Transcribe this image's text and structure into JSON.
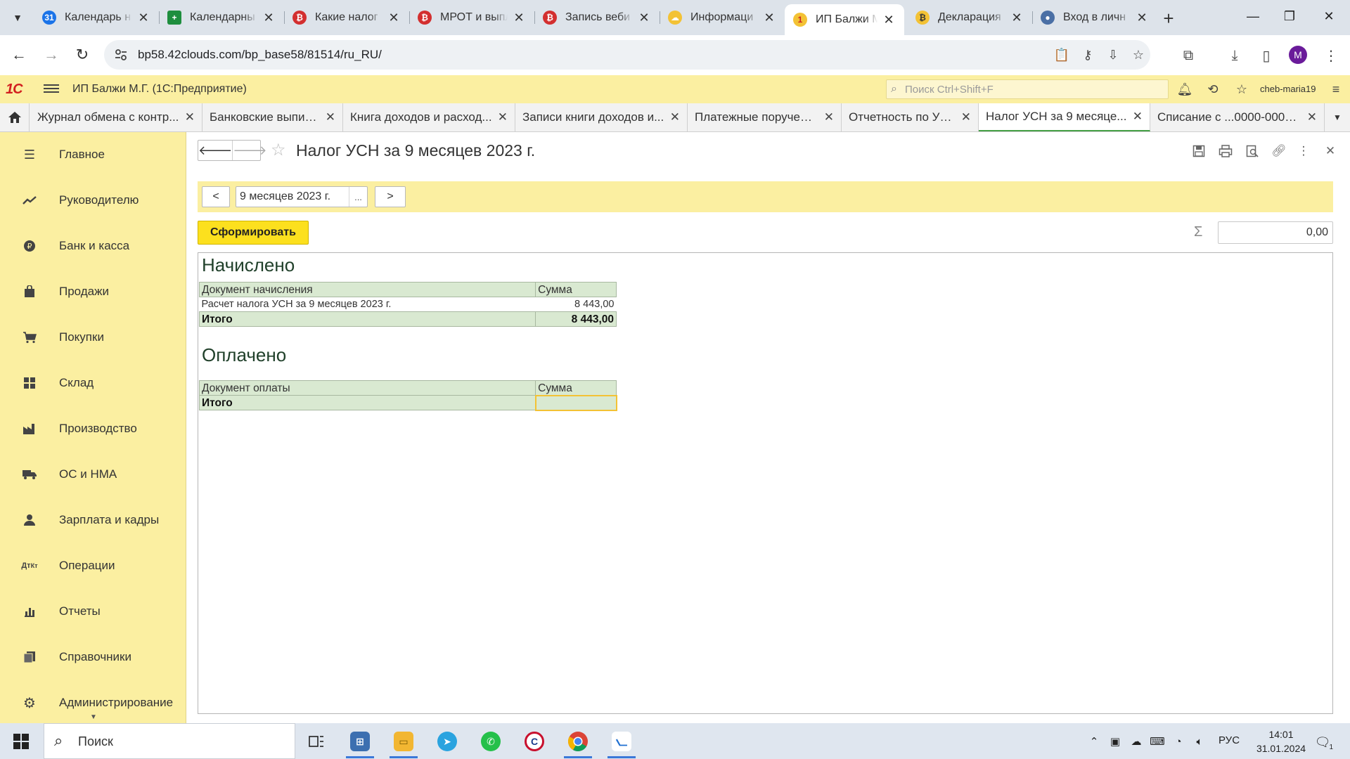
{
  "browser": {
    "tabs": [
      {
        "title": "Календарь н",
        "favicon": "google-calendar-icon",
        "color": "#1a73e8"
      },
      {
        "title": "Календарны",
        "favicon": "google-sheets-icon",
        "color": "#1e8e3e"
      },
      {
        "title": "Какие налог",
        "favicon": "buh-icon",
        "color": "#d32f2f"
      },
      {
        "title": "МРОТ и выпл",
        "favicon": "buh-icon",
        "color": "#d32f2f"
      },
      {
        "title": "Запись веби",
        "favicon": "buh-icon",
        "color": "#d32f2f"
      },
      {
        "title": "Информаци",
        "favicon": "cloud-icon",
        "color": "#f3c235"
      },
      {
        "title": "ИП Балжи М",
        "favicon": "1c-icon",
        "color": "#f3c235"
      },
      {
        "title": "Декларация",
        "favicon": "buh-icon",
        "color": "#f3c235"
      },
      {
        "title": "Вход в личн",
        "favicon": "fns-icon",
        "color": "#4a6fa5"
      }
    ],
    "url": "bp58.42clouds.com/bp_base58/81514/ru_RU/",
    "profile_letter": "M"
  },
  "app": {
    "logo": "1С",
    "title": "ИП Балжи М.Г.  (1С:Предприятие)",
    "search_placeholder": "Поиск Ctrl+Shift+F",
    "user": "cheb-maria19"
  },
  "open_windows": [
    {
      "title": "Журнал обмена с контр..."
    },
    {
      "title": "Банковские выписки"
    },
    {
      "title": "Книга доходов и расход..."
    },
    {
      "title": "Записи книги доходов и..."
    },
    {
      "title": "Платежные поручения"
    },
    {
      "title": "Отчетность по УСН"
    },
    {
      "title": "Налог УСН за 9 месяце...",
      "active": true
    },
    {
      "title": "Списание с ...0000-000021"
    }
  ],
  "sidebar": {
    "items": [
      {
        "label": "Главное",
        "icon": "menu-lines-icon"
      },
      {
        "label": "Руководителю",
        "icon": "trend-icon"
      },
      {
        "label": "Банк и касса",
        "icon": "ruble-coin-icon"
      },
      {
        "label": "Продажи",
        "icon": "shopping-bag-icon"
      },
      {
        "label": "Покупки",
        "icon": "cart-icon"
      },
      {
        "label": "Склад",
        "icon": "warehouse-icon"
      },
      {
        "label": "Производство",
        "icon": "factory-icon"
      },
      {
        "label": "ОС и НМА",
        "icon": "truck-icon"
      },
      {
        "label": "Зарплата и кадры",
        "icon": "person-icon"
      },
      {
        "label": "Операции",
        "icon": "dt-kt-icon"
      },
      {
        "label": "Отчеты",
        "icon": "bar-chart-icon"
      },
      {
        "label": "Справочники",
        "icon": "books-icon"
      },
      {
        "label": "Администрирование",
        "icon": "gear-icon"
      }
    ]
  },
  "form": {
    "title": "Налог УСН за 9 месяцев 2023 г.",
    "period_prev": "<",
    "period_value": "9 месяцев 2023 г.",
    "period_select": "...",
    "period_next": ">",
    "generate_label": "Сформировать",
    "sum_value": "0,00",
    "accrued": {
      "title": "Начислено",
      "col_doc": "Документ начисления",
      "col_sum": "Сумма",
      "rows": [
        {
          "doc": "Расчет налога УСН за 9 месяцев 2023 г.",
          "sum": "8 443,00"
        }
      ],
      "total_label": "Итого",
      "total_sum": "8 443,00"
    },
    "paid": {
      "title": "Оплачено",
      "col_doc": "Документ оплаты",
      "col_sum": "Сумма",
      "total_label": "Итого",
      "total_sum": ""
    }
  },
  "taskbar": {
    "search_placeholder": "Поиск",
    "language": "РУС",
    "time": "14:01",
    "date": "31.01.2024",
    "notification_count": "1"
  }
}
